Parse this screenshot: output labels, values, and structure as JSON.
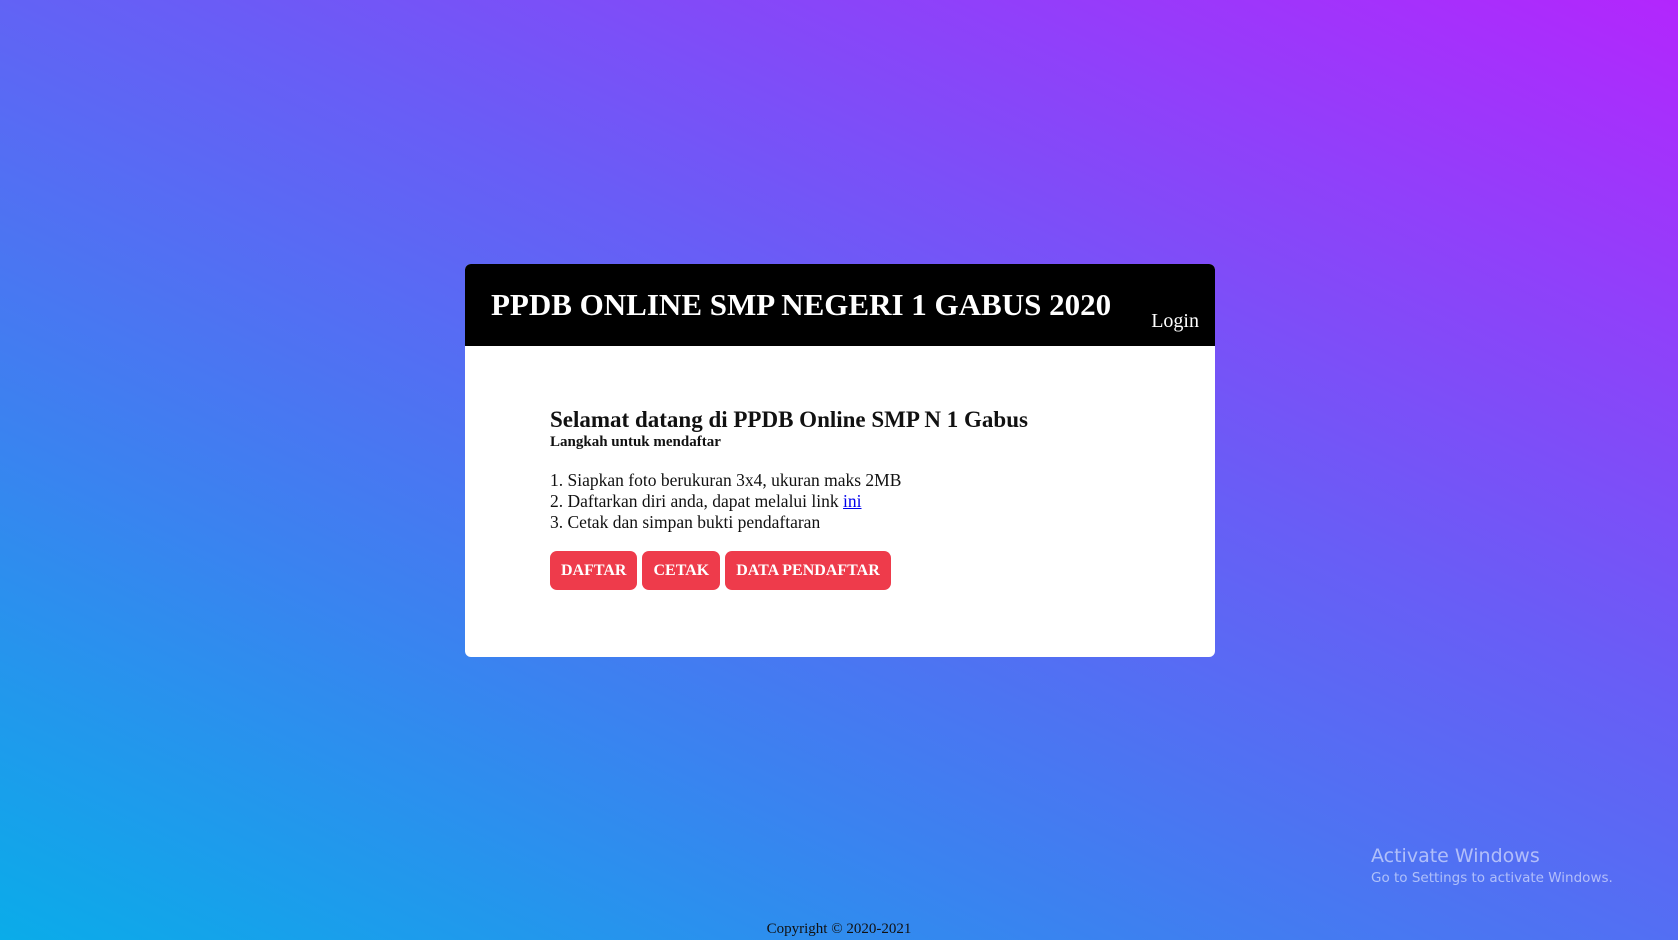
{
  "header": {
    "title": "PPDB ONLINE SMP NEGERI 1 GABUS 2020",
    "login_label": "Login"
  },
  "main": {
    "welcome": "Selamat datang di PPDB Online SMP N 1 Gabus",
    "subtitle": "Langkah untuk mendaftar",
    "steps": {
      "step1": "1. Siapkan foto berukuran 3x4, ukuran maks 2MB",
      "step2_prefix": "2. Daftarkan diri anda, dapat melalui link ",
      "step2_link": "ini",
      "step3": "3. Cetak dan simpan bukti pendaftaran"
    },
    "buttons": {
      "daftar": "DAFTAR",
      "cetak": "CETAK",
      "data_pendaftar": "DATA PENDAFTAR"
    }
  },
  "footer": {
    "copyright": "Copyright © 2020-2021"
  },
  "watermark": {
    "title": "Activate Windows",
    "subtitle": "Go to Settings to activate Windows."
  },
  "colors": {
    "button": "#ee3b4b",
    "header_bg": "#000000",
    "gradient_start": "#0aace9",
    "gradient_end": "#b326fd"
  }
}
